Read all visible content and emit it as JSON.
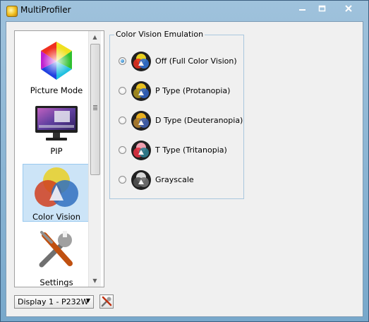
{
  "window": {
    "title": "MultiProfiler"
  },
  "sidebar": {
    "items": [
      {
        "label": "Picture Mode",
        "icon": "color-wheel-icon",
        "selected": false
      },
      {
        "label": "PIP",
        "icon": "monitor-icon",
        "selected": false
      },
      {
        "label": "Color Vision",
        "icon": "color-vision-icon",
        "selected": true
      },
      {
        "label": "Settings",
        "icon": "tools-icon",
        "selected": false
      }
    ]
  },
  "color_vision": {
    "group_title": "Color Vision Emulation",
    "options": [
      {
        "label": "Off (Full Color Vision)",
        "checked": true,
        "colors": [
          "#e8d020",
          "#3070d0",
          "#e03020"
        ]
      },
      {
        "label": "P Type (Protanopia)",
        "checked": false,
        "colors": [
          "#e8c020",
          "#3060c0",
          "#a89020"
        ]
      },
      {
        "label": "D Type (Deuteranopia)",
        "checked": false,
        "colors": [
          "#e8b020",
          "#4060b0",
          "#b08030"
        ]
      },
      {
        "label": "T Type (Tritanopia)",
        "checked": false,
        "colors": [
          "#f0a0b0",
          "#308090",
          "#e03040"
        ]
      },
      {
        "label": "Grayscale",
        "checked": false,
        "colors": [
          "#d8d8d8",
          "#707070",
          "#505050"
        ]
      }
    ]
  },
  "footer": {
    "display_select": "Display 1 - P232W",
    "tool_icon": "tools-icon"
  },
  "colors": {
    "title_bg": "#9fc2dc",
    "selection": "#cce4f7",
    "accent": "#1a6aa8"
  }
}
